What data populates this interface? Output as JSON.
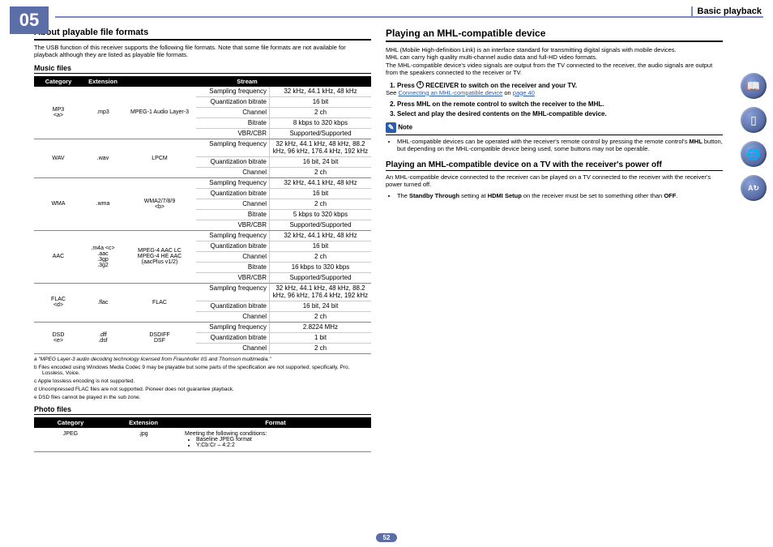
{
  "chapter": "05",
  "section": "Basic playback",
  "pagenum": "52",
  "left": {
    "h2": "About playable file formats",
    "intro": "The USB function of this receiver supports the following file formats. Note that some file formats are not available for playback although they are listed as playable file formats.",
    "music_h": "Music files",
    "mhdr": {
      "cat": "Category",
      "ext": "Extension",
      "str": "Stream"
    },
    "groups": [
      {
        "cat": "MP3\n<a>",
        "ext": ".mp3",
        "str": "MPEG-1 Audio Layer-3",
        "rows": [
          [
            "Sampling frequency",
            "32 kHz, 44.1 kHz, 48 kHz"
          ],
          [
            "Quantization bitrate",
            "16 bit"
          ],
          [
            "Channel",
            "2 ch"
          ],
          [
            "Bitrate",
            "8 kbps to 320 kbps"
          ],
          [
            "VBR/CBR",
            "Supported/Supported"
          ]
        ]
      },
      {
        "cat": "WAV",
        "ext": ".wav",
        "str": "LPCM",
        "rows": [
          [
            "Sampling frequency",
            "32 kHz, 44.1 kHz, 48 kHz, 88.2 kHz, 96 kHz, 176.4 kHz, 192 kHz"
          ],
          [
            "Quantization bitrate",
            "16 bit, 24 bit"
          ],
          [
            "Channel",
            "2 ch"
          ]
        ]
      },
      {
        "cat": "WMA",
        "ext": ".wma",
        "str": "WMA2/7/8/9\n<b>",
        "rows": [
          [
            "Sampling frequency",
            "32 kHz, 44.1 kHz, 48 kHz"
          ],
          [
            "Quantization bitrate",
            "16 bit"
          ],
          [
            "Channel",
            "2 ch"
          ],
          [
            "Bitrate",
            "5 kbps to 320 kbps"
          ],
          [
            "VBR/CBR",
            "Supported/Supported"
          ]
        ]
      },
      {
        "cat": "AAC",
        "ext": ".m4a <c>\n.aac\n.3gp\n.3g2",
        "str": "MPEG-4 AAC LC\nMPEG-4 HE AAC\n(aacPlus v1/2)",
        "rows": [
          [
            "Sampling frequency",
            "32 kHz, 44.1 kHz, 48 kHz"
          ],
          [
            "Quantization bitrate",
            "16 bit"
          ],
          [
            "Channel",
            "2 ch"
          ],
          [
            "Bitrate",
            "16 kbps to 320 kbps"
          ],
          [
            "VBR/CBR",
            "Supported/Supported"
          ]
        ]
      },
      {
        "cat": "FLAC\n<d>",
        "ext": ".flac",
        "str": "FLAC",
        "rows": [
          [
            "Sampling frequency",
            "32 kHz, 44.1 kHz, 48 kHz, 88.2 kHz, 96 kHz, 176.4 kHz, 192 kHz"
          ],
          [
            "Quantization bitrate",
            "16 bit, 24 bit"
          ],
          [
            "Channel",
            "2 ch"
          ]
        ]
      },
      {
        "cat": "DSD\n<e>",
        "ext": ".dff\n.dsf",
        "str": "DSDIFF\nDSF",
        "rows": [
          [
            "Sampling frequency",
            "2.8224 MHz"
          ],
          [
            "Quantization bitrate",
            "1 bit"
          ],
          [
            "Channel",
            "2 ch"
          ]
        ]
      }
    ],
    "fns": [
      "a   \"MPEG Layer-3 audio decoding technology licensed from Fraunhofer IIS and Thomson multimedia.\"",
      "b   Files encoded using Windows Media Codec 9 may be playable but some parts of the specification are not supported; specifically, Pro, Lossless, Voice.",
      "c   Apple lossless encoding is not supported.",
      "d   Uncompressed FLAC files are not supported. Pioneer does not guarantee playback.",
      "e   DSD files cannot be played in the sub zone."
    ],
    "photo_h": "Photo files",
    "phdr": {
      "cat": "Category",
      "ext": "Extension",
      "fmt": "Format"
    },
    "photo": {
      "cat": "JPEG",
      "ext": ".jpg",
      "cond": "Meeting the following conditions:",
      "b1": "Baseline JPEG format",
      "b2": "Y:Cb:Cr – 4:2:2"
    }
  },
  "right": {
    "h3": "Playing an MHL-compatible device",
    "p1": "MHL (Mobile High-definition Link) is an interface standard for transmitting digital signals with mobile devices.",
    "p2": "MHL can carry high quality multi-channel audio data and full-HD video formats.",
    "p3": "The MHL-compatible device's video signals are output from the TV connected to the receiver, the audio signals are output from the speakers connected to the receiver or TV.",
    "s1a": "Press ",
    "s1b": " RECEIVER to switch on the receiver and your TV.",
    "see": "See ",
    "link": "Connecting an MHL-compatible device",
    "on": " on ",
    "pg": "page 40",
    ".": ".",
    "s2": "Press MHL on the remote control to switch the receiver to the MHL.",
    "s3": "Select and play the desired contents on the MHL-compatible device.",
    "note": "Note",
    "nb1a": "MHL-compatible devices can be operated with the receiver's remote control by pressing the remote control's ",
    "nb1b": "MHL",
    "nb1c": " button, but depending on the MHL-compatible device being used, some buttons may not be operable.",
    "h4": "Playing an MHL-compatible device on a TV with the receiver's power off",
    "p4": "An MHL-compatible device connected to the receiver can be played on a TV connected to the receiver with the receiver's power turned off.",
    "b2a": "The ",
    "b2b": "Standby Through",
    "b2c": " setting at ",
    "b2d": "HDMI Setup",
    "b2e": " on the receiver must be set to something other than ",
    "b2f": "OFF",
    "b2g": "."
  }
}
